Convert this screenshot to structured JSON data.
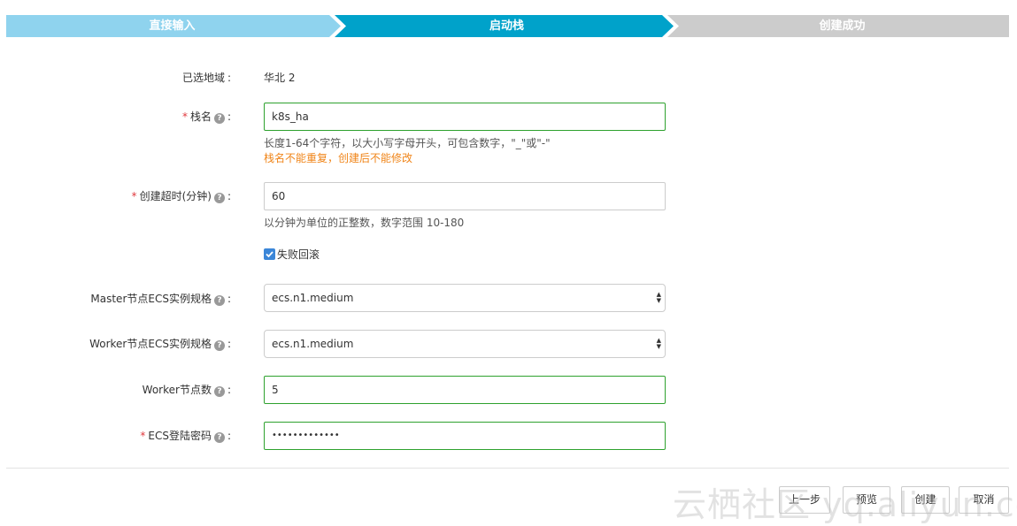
{
  "steps": [
    {
      "label": "直接输入",
      "state": "done",
      "color": "#8fd3ee"
    },
    {
      "label": "启动栈",
      "state": "active",
      "color": "#00a2ca"
    },
    {
      "label": "创建成功",
      "state": "pending",
      "color": "#cccccc"
    }
  ],
  "form": {
    "region": {
      "label": "已选地域",
      "value": "华北 2"
    },
    "stack_name": {
      "label": "栈名",
      "required": true,
      "value": "k8s_ha",
      "hint": "长度1-64个字符，以大小写字母开头，可包含数字，\"_\"或\"-\"",
      "warning": "栈名不能重复，创建后不能修改"
    },
    "timeout": {
      "label": "创建超时(分钟)",
      "required": true,
      "value": "60",
      "hint": "以分钟为单位的正整数，数字范围 10-180"
    },
    "rollback": {
      "label": "失败回滚",
      "checked": true
    },
    "master_spec": {
      "label": "Master节点ECS实例规格",
      "value": "ecs.n1.medium"
    },
    "worker_spec": {
      "label": "Worker节点ECS实例规格",
      "value": "ecs.n1.medium"
    },
    "worker_count": {
      "label": "Worker节点数",
      "value": "5"
    },
    "ecs_password": {
      "label": "ECS登陆密码",
      "required": true,
      "value": "•••••••••••••"
    }
  },
  "help_glyph": "?",
  "colon": ":",
  "required_mark": "*",
  "buttons": {
    "prev": "上一步",
    "preview": "预览",
    "create": "创建",
    "cancel": "取消"
  },
  "watermark": "云栖社区 yq.aliyun.com",
  "colors": {
    "valid_border": "#2ea12e",
    "warning_text": "#f08519",
    "required": "#e0393e",
    "checkbox": "#3b86d8"
  }
}
